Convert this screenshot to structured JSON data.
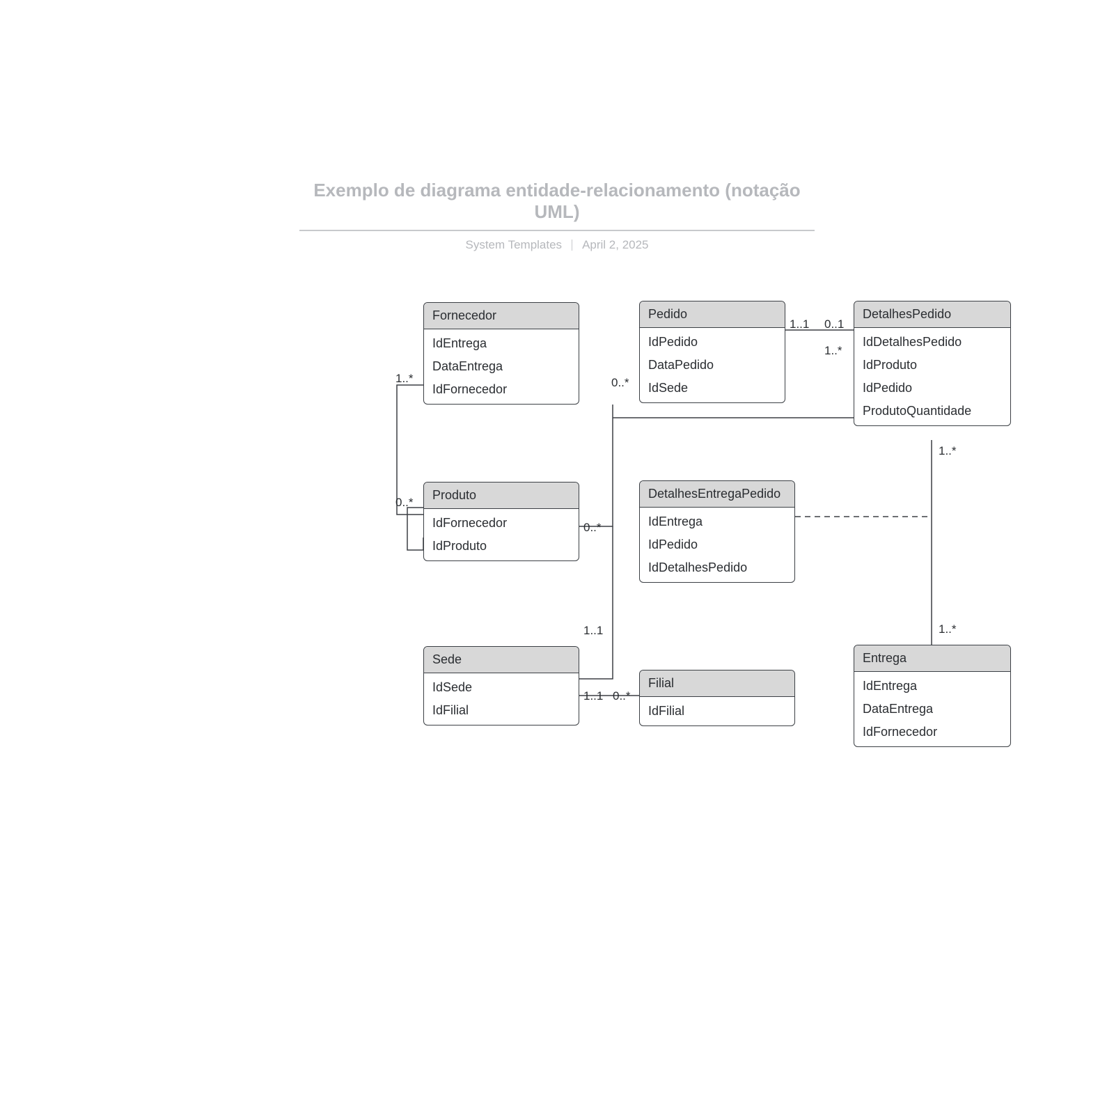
{
  "title": "Exemplo de diagrama entidade-relacionamento (notação UML)",
  "subtitle_left": "System Templates",
  "subtitle_right": "April 2, 2025",
  "entities": {
    "fornecedor": {
      "name": "Fornecedor",
      "attrs": [
        "IdEntrega",
        "DataEntrega",
        "IdFornecedor"
      ]
    },
    "pedido": {
      "name": "Pedido",
      "attrs": [
        "IdPedido",
        "DataPedido",
        "IdSede"
      ]
    },
    "detalhespedido": {
      "name": "DetalhesPedido",
      "attrs": [
        "IdDetalhesPedido",
        "IdProduto",
        "IdPedido",
        "ProdutoQuantidade"
      ]
    },
    "produto": {
      "name": "Produto",
      "attrs": [
        "IdFornecedor",
        "IdProduto"
      ]
    },
    "detalhesentregapedido": {
      "name": "DetalhesEntregaPedido",
      "attrs": [
        "IdEntrega",
        "IdPedido",
        "IdDetalhesPedido"
      ]
    },
    "sede": {
      "name": "Sede",
      "attrs": [
        "IdSede",
        "IdFilial"
      ]
    },
    "filial": {
      "name": "Filial",
      "attrs": [
        "IdFilial"
      ]
    },
    "entrega": {
      "name": "Entrega",
      "attrs": [
        "IdEntrega",
        "DataEntrega",
        "IdFornecedor"
      ]
    }
  },
  "multiplicities": {
    "m1": "1..*",
    "m2": "0..*",
    "m3": "1..1",
    "m4": "0..1",
    "m5": "1..*",
    "m6": "0..*",
    "m7": "1..*",
    "m8": "1..*",
    "m9": "0..*",
    "m10": "1..1",
    "m11": "1..1",
    "m12": "0..*"
  }
}
